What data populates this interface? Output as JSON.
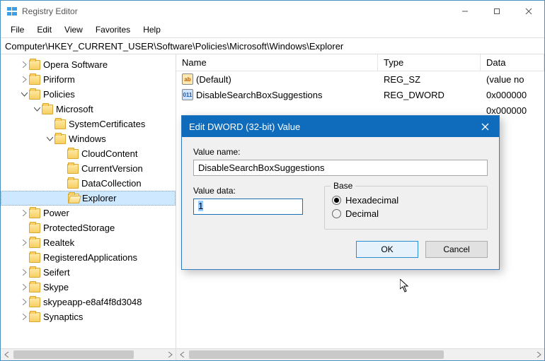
{
  "window": {
    "title": "Registry Editor"
  },
  "menu": [
    "File",
    "Edit",
    "View",
    "Favorites",
    "Help"
  ],
  "address": "Computer\\HKEY_CURRENT_USER\\Software\\Policies\\Microsoft\\Windows\\Explorer",
  "tree": {
    "opera": "Opera Software",
    "piriform": "Piriform",
    "policies": "Policies",
    "microsoft": "Microsoft",
    "syscerts": "SystemCertificates",
    "windows": "Windows",
    "cloudcontent": "CloudContent",
    "currentversion": "CurrentVersion",
    "datacollection": "DataCollection",
    "explorer": "Explorer",
    "power": "Power",
    "protectedstorage": "ProtectedStorage",
    "realtek": "Realtek",
    "regapps": "RegisteredApplications",
    "seifert": "Seifert",
    "skype": "Skype",
    "skypeapp": "skypeapp-e8af4f8d3048",
    "synaptics": "Synaptics"
  },
  "list": {
    "headers": {
      "name": "Name",
      "type": "Type",
      "data": "Data"
    },
    "rows": [
      {
        "icon": "str",
        "name": "(Default)",
        "type": "REG_SZ",
        "data": "(value no"
      },
      {
        "icon": "dword",
        "name": "DisableSearchBoxSuggestions",
        "type": "REG_DWORD",
        "data": "0x000000"
      },
      {
        "icon": "dword",
        "name": "",
        "type": "",
        "data": "0x000000"
      }
    ]
  },
  "dialog": {
    "title": "Edit DWORD (32-bit) Value",
    "value_name_label": "Value name:",
    "value_name": "DisableSearchBoxSuggestions",
    "value_data_label": "Value data:",
    "value_data": "1",
    "base_label": "Base",
    "base_hex": "Hexadecimal",
    "base_dec": "Decimal",
    "ok": "OK",
    "cancel": "Cancel"
  }
}
